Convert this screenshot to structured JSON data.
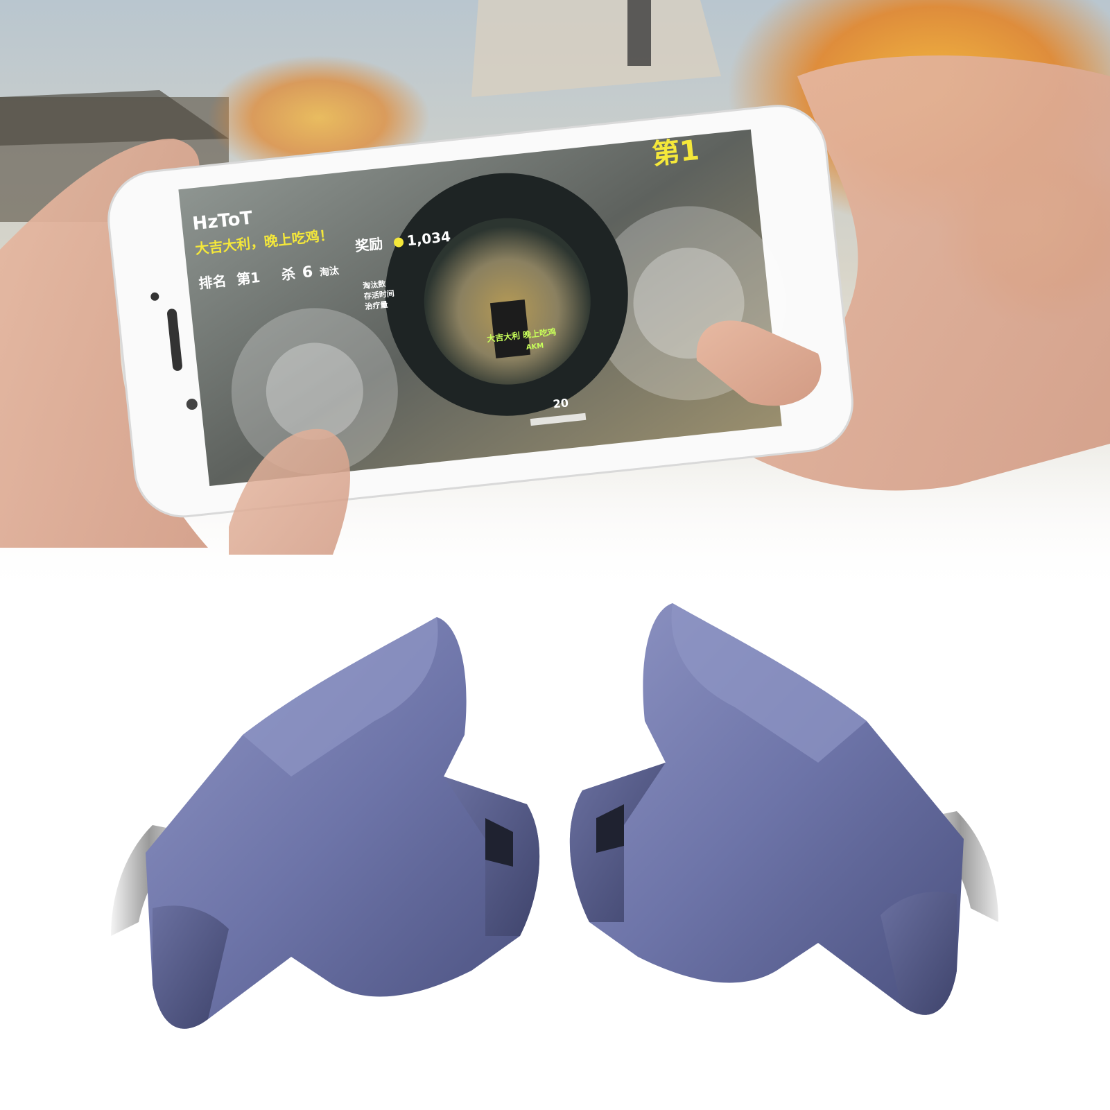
{
  "hud": {
    "player_name": "HzToT",
    "slogan": "大吉大利，晚上吃鸡！",
    "rank_label": "排名",
    "rank_value": "第1",
    "kills_label": "杀",
    "kills_value": "6",
    "kills_unit": "淘汰",
    "reward_label": "奖励",
    "reward_value": "1,034",
    "rank_badge": "第1",
    "ammo": "20",
    "stats_lines": [
      "淘汰数",
      "存活时间",
      "治疗量"
    ],
    "scope_msg_1": "大吉大利 晚上吃鸡",
    "scope_msg_2": "AKM"
  },
  "colors": {
    "trigger_body": "#6d74a8",
    "trigger_dark": "#4a507e",
    "trigger_light": "#8f95c4",
    "hud_yellow": "#f5e83a",
    "phone_white": "#fafafa"
  }
}
